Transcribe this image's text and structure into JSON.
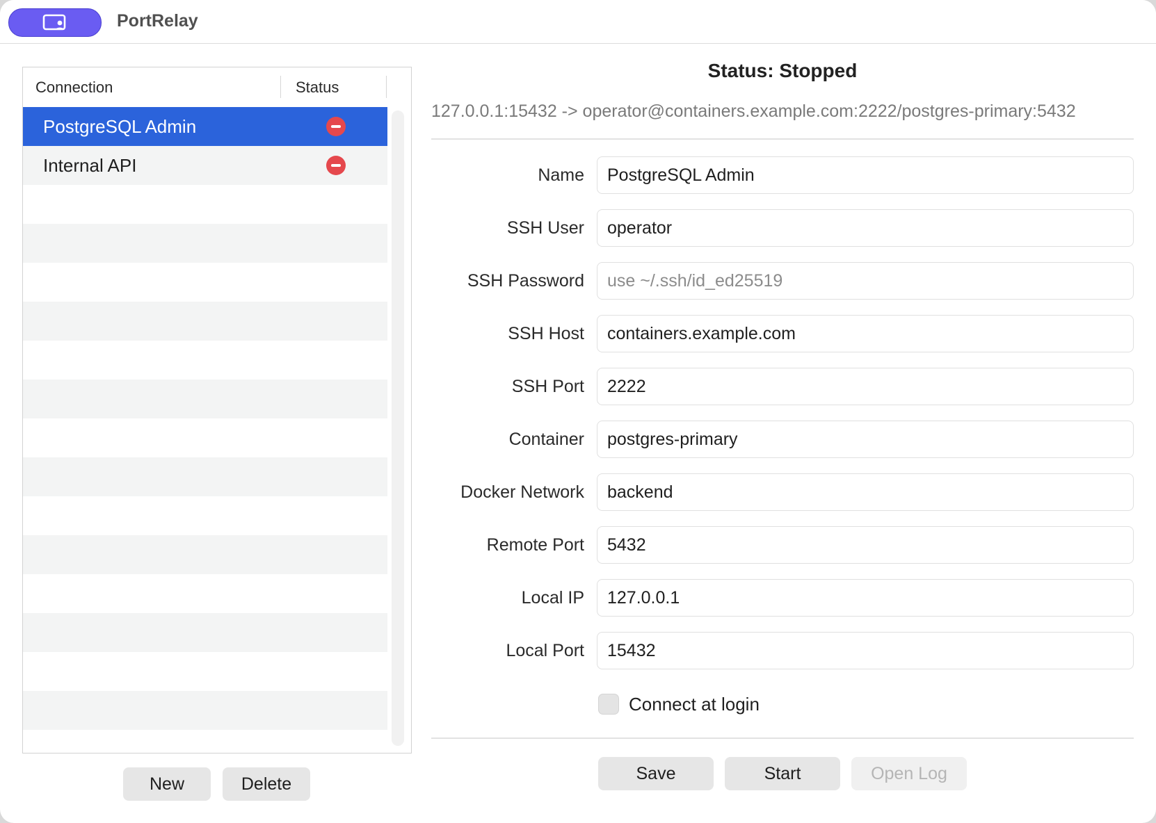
{
  "app": {
    "title": "PortRelay"
  },
  "list": {
    "columns": {
      "connection": "Connection",
      "status": "Status"
    },
    "items": [
      {
        "label": "PostgreSQL Admin",
        "status": "stopped",
        "selected": true
      },
      {
        "label": "Internal API",
        "status": "stopped",
        "selected": false
      }
    ],
    "buttons": {
      "new": "New",
      "delete": "Delete"
    }
  },
  "detail": {
    "status_title": "Status: Stopped",
    "route": "127.0.0.1:15432 -> operator@containers.example.com:2222/postgres-primary:5432",
    "fields": {
      "name": {
        "label": "Name",
        "value": "PostgreSQL Admin",
        "placeholder": ""
      },
      "ssh_user": {
        "label": "SSH User",
        "value": "operator",
        "placeholder": ""
      },
      "ssh_password": {
        "label": "SSH Password",
        "value": "",
        "placeholder": "use ~/.ssh/id_ed25519"
      },
      "ssh_host": {
        "label": "SSH Host",
        "value": "containers.example.com",
        "placeholder": ""
      },
      "ssh_port": {
        "label": "SSH Port",
        "value": "2222",
        "placeholder": ""
      },
      "container": {
        "label": "Container",
        "value": "postgres-primary",
        "placeholder": ""
      },
      "docker_network": {
        "label": "Docker Network",
        "value": "backend",
        "placeholder": ""
      },
      "remote_port": {
        "label": "Remote Port",
        "value": "5432",
        "placeholder": ""
      },
      "local_ip": {
        "label": "Local IP",
        "value": "127.0.0.1",
        "placeholder": ""
      },
      "local_port": {
        "label": "Local Port",
        "value": "15432",
        "placeholder": ""
      }
    },
    "connect_at_login": {
      "label": "Connect at login",
      "checked": false
    },
    "buttons": {
      "save": "Save",
      "start": "Start",
      "open_log": "Open Log"
    }
  },
  "colors": {
    "accent": "#6a5cf2",
    "selection": "#2b63db",
    "status_stopped": "#e5484d"
  }
}
